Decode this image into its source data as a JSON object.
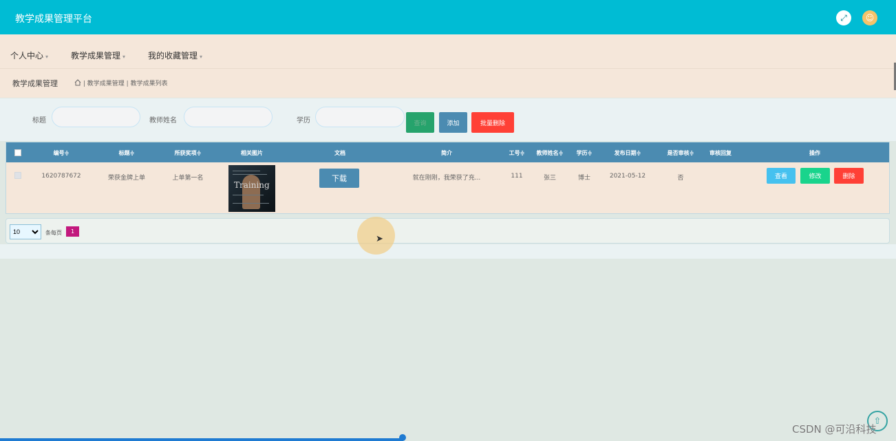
{
  "app": {
    "title": "教学成果管理平台",
    "expand_icon": "expand-icon",
    "user_icon": "user-icon"
  },
  "nav": [
    {
      "label": "个人中心"
    },
    {
      "label": "教学成果管理"
    },
    {
      "label": "我的收藏管理"
    }
  ],
  "breadcrumb": {
    "title": "教学成果管理",
    "path_1": "教学成果管理",
    "path_2": "教学成果列表"
  },
  "search": {
    "title_label": "标题",
    "teacher_label": "教师姓名",
    "education_label": "学历",
    "search_button": "查询",
    "add_button": "添加",
    "batch_delete_button": "批量删除"
  },
  "table": {
    "headers": [
      "编号",
      "标题",
      "所获奖项",
      "相关图片",
      "文档",
      "简介",
      "工号",
      "教师姓名",
      "学历",
      "发布日期",
      "是否审核",
      "审核回复",
      "操作"
    ],
    "sortable_marker": "≑",
    "row": {
      "id": "1620787672",
      "title": "荣获金牌上单",
      "award": "上单第一名",
      "image_words": "Training",
      "doc_button": "下载",
      "intro": "就在刚刚，我荣获了充...",
      "job_no": "111",
      "teacher": "张三",
      "education": "博士",
      "date": "2021-05-12",
      "approved": "否",
      "reply": "",
      "view": "查看",
      "edit": "修改",
      "delete": "删除"
    }
  },
  "pagination": {
    "page_size": "10",
    "per_page_label": "条每页",
    "current_page": "1"
  },
  "footer": {
    "watermark": "CSDN @可沿科技",
    "scroll_up_icon": "arrow-up-icon"
  },
  "colors": {
    "primary": "#00bcd4",
    "table_header": "#4b8bb1",
    "danger": "#ff4036",
    "success": "#19d48c",
    "info": "#45c1ef"
  }
}
